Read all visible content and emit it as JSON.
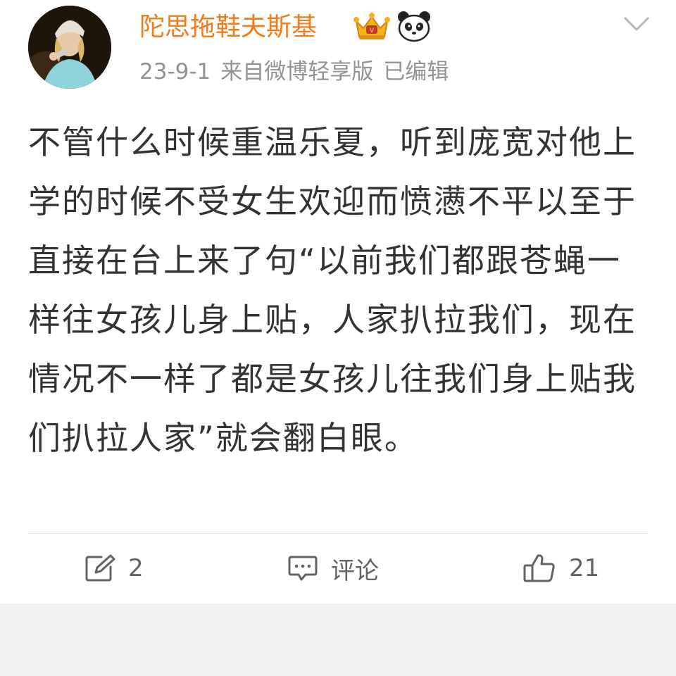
{
  "post": {
    "username": "陀思拖鞋夫斯基",
    "date": "23-9-1",
    "source": "来自微博轻享版",
    "edited": "已编辑",
    "content": "不管什么时候重温乐夏，听到庞宽对他上学的时候不受女生欢迎而愤懑不平以至于直接在台上来了句“以前我们都跟苍蝇一样往女孩儿身上贴，人家扒拉我们，现在情况不一样了都是女孩儿往我们身上贴我们扒拉人家”就会翻白眼。"
  },
  "badges": [
    "crown-badge-icon",
    "panda-badge-icon"
  ],
  "actions": {
    "repost_count": "2",
    "comment_label": "评论",
    "like_count": "21"
  },
  "colors": {
    "username": "#f07c1b",
    "meta": "#939393",
    "text": "#333333",
    "background": "#f2f2f2"
  }
}
